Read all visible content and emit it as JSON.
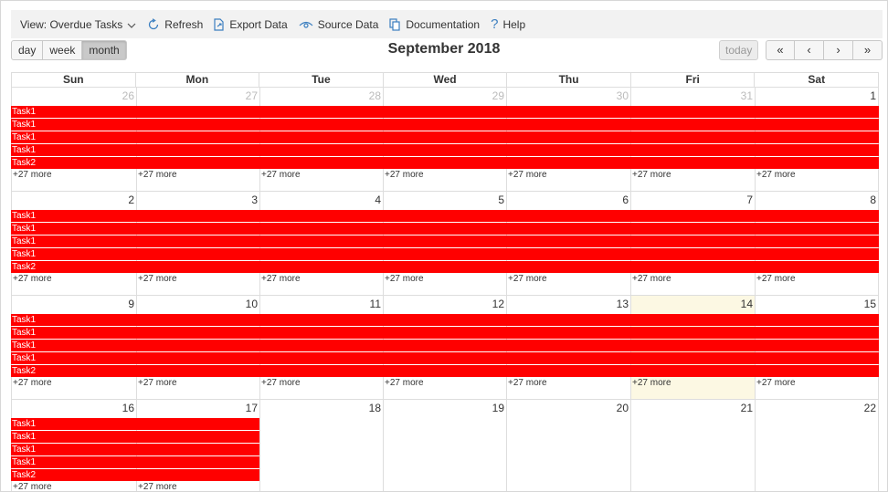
{
  "toolbar": {
    "view_label": "View: Overdue Tasks",
    "refresh": "Refresh",
    "export": "Export Data",
    "source": "Source Data",
    "documentation": "Documentation",
    "help": "Help"
  },
  "view_buttons": {
    "day": "day",
    "week": "week",
    "month": "month",
    "active": "month"
  },
  "calendar": {
    "title": "September 2018",
    "today_label": "today",
    "nav": {
      "prev_year": "«",
      "prev": "‹",
      "next": "›",
      "next_year": "»"
    },
    "days_of_week": [
      "Sun",
      "Mon",
      "Tue",
      "Wed",
      "Thu",
      "Fri",
      "Sat"
    ],
    "today_date": "14",
    "weeks": [
      {
        "days": [
          "26",
          "27",
          "28",
          "29",
          "30",
          "31",
          "1"
        ],
        "other_month": [
          true,
          true,
          true,
          true,
          true,
          true,
          false
        ],
        "events": [
          "Task1",
          "Task1",
          "Task1",
          "Task1",
          "Task2"
        ],
        "span_days": 7,
        "more": [
          "+27 more",
          "+27 more",
          "+27 more",
          "+27 more",
          "+27 more",
          "+27 more",
          "+27 more"
        ]
      },
      {
        "days": [
          "2",
          "3",
          "4",
          "5",
          "6",
          "7",
          "8"
        ],
        "other_month": [
          false,
          false,
          false,
          false,
          false,
          false,
          false
        ],
        "events": [
          "Task1",
          "Task1",
          "Task1",
          "Task1",
          "Task2"
        ],
        "span_days": 7,
        "more": [
          "+27 more",
          "+27 more",
          "+27 more",
          "+27 more",
          "+27 more",
          "+27 more",
          "+27 more"
        ]
      },
      {
        "days": [
          "9",
          "10",
          "11",
          "12",
          "13",
          "14",
          "15"
        ],
        "other_month": [
          false,
          false,
          false,
          false,
          false,
          false,
          false
        ],
        "events": [
          "Task1",
          "Task1",
          "Task1",
          "Task1",
          "Task2"
        ],
        "span_days": 7,
        "more": [
          "+27 more",
          "+27 more",
          "+27 more",
          "+27 more",
          "+27 more",
          "+27 more",
          "+27 more"
        ]
      },
      {
        "days": [
          "16",
          "17",
          "18",
          "19",
          "20",
          "21",
          "22"
        ],
        "other_month": [
          false,
          false,
          false,
          false,
          false,
          false,
          false
        ],
        "events": [
          "Task1",
          "Task1",
          "Task1",
          "Task1",
          "Task2"
        ],
        "span_days": 2,
        "more": [
          "+27 more",
          "+27 more"
        ]
      }
    ]
  },
  "colors": {
    "event": "#ff0000",
    "today_bg": "#fcf8e3",
    "icon": "#3c7fc0"
  }
}
